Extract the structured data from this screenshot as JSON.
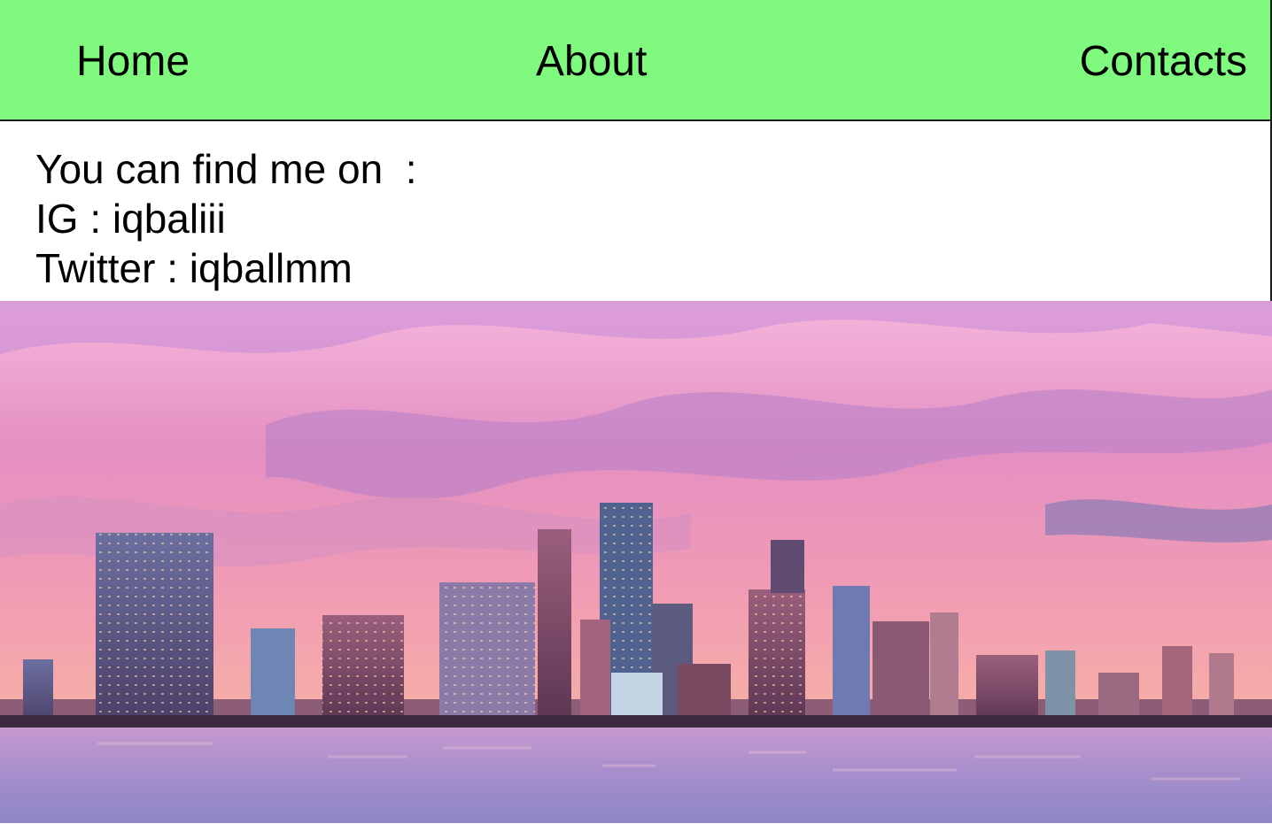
{
  "nav": {
    "items": [
      {
        "label": "Home"
      },
      {
        "label": "About"
      },
      {
        "label": "Contacts"
      }
    ],
    "background": "#80f97f"
  },
  "contacts": {
    "intro": "You can find me on  :",
    "instagram": "IG : iqbaliii",
    "twitter": "Twitter : iqballmm"
  },
  "hero": {
    "subject": "city-skyline-at-sunset-photo",
    "sky_colors": [
      "#f3a9d8",
      "#e98fc0",
      "#f0a3b9",
      "#f7b3a6"
    ],
    "water_color": "#b98fc8"
  }
}
